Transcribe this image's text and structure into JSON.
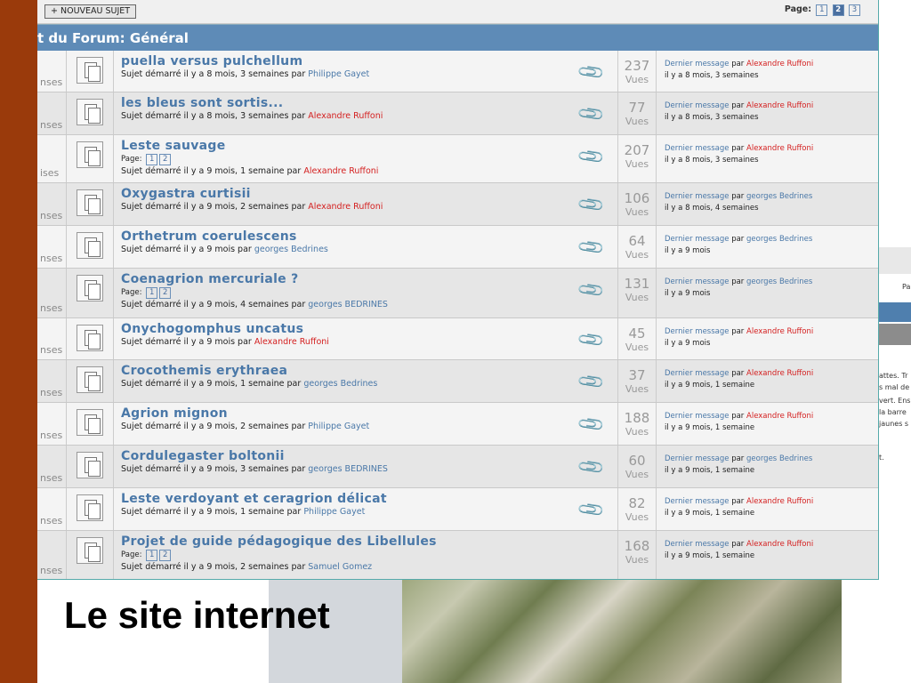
{
  "toolbar": {
    "new_topic_label": "+ NOUVEAU SUJET",
    "page_label": "Page:",
    "pages": [
      "1",
      "2",
      "3"
    ],
    "active_page": "2"
  },
  "forum_title": "t du Forum: Général",
  "caption": "Le site internet",
  "bg_window_texts": [
    "Pa",
    "attes. Tr",
    "s mal de",
    "vert. Ens",
    "la barre",
    "jaunes s",
    "t."
  ],
  "topics": [
    {
      "title": "puella versus pulchellum",
      "pages": [],
      "meta": "Sujet démarré il y a 8 mois, 3 semaines par",
      "author": "Philippe Gayet",
      "author_color": "blue",
      "views": "237",
      "views_label": "Vues",
      "last_label": "Dernier message",
      "last_par": "par",
      "last_author": "Alexandre Ruffoni",
      "last_color": "red",
      "last_when": "il y a 8 mois, 3 semaines",
      "resp": "nses",
      "clip": true
    },
    {
      "title": "les bleus sont sortis...",
      "pages": [],
      "meta": "Sujet démarré il y a 8 mois, 3 semaines par",
      "author": "Alexandre Ruffoni",
      "author_color": "red",
      "views": "77",
      "views_label": "Vues",
      "last_label": "Dernier message",
      "last_par": "par",
      "last_author": "Alexandre Ruffoni",
      "last_color": "red",
      "last_when": "il y a 8 mois, 3 semaines",
      "resp": "nses",
      "clip": true
    },
    {
      "title": "Leste sauvage",
      "pages": [
        "1",
        "2"
      ],
      "meta": "Sujet démarré il y a 9 mois, 1 semaine par",
      "author": "Alexandre Ruffoni",
      "author_color": "red",
      "views": "207",
      "views_label": "Vues",
      "last_label": "Dernier message",
      "last_par": "par",
      "last_author": "Alexandre Ruffoni",
      "last_color": "red",
      "last_when": "il y a 8 mois, 3 semaines",
      "resp": "ises",
      "clip": true
    },
    {
      "title": "Oxygastra curtisii",
      "pages": [],
      "meta": "Sujet démarré il y a 9 mois, 2 semaines par",
      "author": "Alexandre Ruffoni",
      "author_color": "red",
      "views": "106",
      "views_label": "Vues",
      "last_label": "Dernier message",
      "last_par": "par",
      "last_author": "georges Bedrines",
      "last_color": "blue",
      "last_when": "il y a 8 mois, 4 semaines",
      "resp": "nses",
      "clip": true
    },
    {
      "title": "Orthetrum coerulescens",
      "pages": [],
      "meta": "Sujet démarré il y a 9 mois par",
      "author": "georges Bedrines",
      "author_color": "blue",
      "views": "64",
      "views_label": "Vues",
      "last_label": "Dernier message",
      "last_par": "par",
      "last_author": "georges Bedrines",
      "last_color": "blue",
      "last_when": "il y a 9 mois",
      "resp": "nses",
      "clip": true
    },
    {
      "title": "Coenagrion mercuriale ?",
      "pages": [
        "1",
        "2"
      ],
      "meta": "Sujet démarré il y a 9 mois, 4 semaines par",
      "author": "georges BEDRINES",
      "author_color": "blue",
      "views": "131",
      "views_label": "Vues",
      "last_label": "Dernier message",
      "last_par": "par",
      "last_author": "georges Bedrines",
      "last_color": "blue",
      "last_when": "il y a 9 mois",
      "resp": "nses",
      "clip": true
    },
    {
      "title": "Onychogomphus uncatus",
      "pages": [],
      "meta": "Sujet démarré il y a 9 mois par",
      "author": "Alexandre Ruffoni",
      "author_color": "red",
      "views": "45",
      "views_label": "Vues",
      "last_label": "Dernier message",
      "last_par": "par",
      "last_author": "Alexandre Ruffoni",
      "last_color": "red",
      "last_when": "il y a 9 mois",
      "resp": "nses",
      "clip": true
    },
    {
      "title": "Crocothemis erythraea",
      "pages": [],
      "meta": "Sujet démarré il y a 9 mois, 1 semaine par",
      "author": "georges Bedrines",
      "author_color": "blue",
      "views": "37",
      "views_label": "Vues",
      "last_label": "Dernier message",
      "last_par": "par",
      "last_author": "Alexandre Ruffoni",
      "last_color": "red",
      "last_when": "il y a 9 mois, 1 semaine",
      "resp": "nses",
      "clip": true
    },
    {
      "title": "Agrion mignon",
      "pages": [],
      "meta": "Sujet démarré il y a 9 mois, 2 semaines par",
      "author": "Philippe Gayet",
      "author_color": "blue",
      "views": "188",
      "views_label": "Vues",
      "last_label": "Dernier message",
      "last_par": "par",
      "last_author": "Alexandre Ruffoni",
      "last_color": "red",
      "last_when": "il y a 9 mois, 1 semaine",
      "resp": "nses",
      "clip": true
    },
    {
      "title": "Cordulegaster boltonii",
      "pages": [],
      "meta": "Sujet démarré il y a 9 mois, 3 semaines par",
      "author": "georges BEDRINES",
      "author_color": "blue",
      "views": "60",
      "views_label": "Vues",
      "last_label": "Dernier message",
      "last_par": "par",
      "last_author": "georges Bedrines",
      "last_color": "blue",
      "last_when": "il y a 9 mois, 1 semaine",
      "resp": "nses",
      "clip": true
    },
    {
      "title": "Leste verdoyant et ceragrion délicat",
      "pages": [],
      "meta": "Sujet démarré il y a 9 mois, 1 semaine par",
      "author": "Philippe Gayet",
      "author_color": "blue",
      "views": "82",
      "views_label": "Vues",
      "last_label": "Dernier message",
      "last_par": "par",
      "last_author": "Alexandre Ruffoni",
      "last_color": "red",
      "last_when": "il y a 9 mois, 1 semaine",
      "resp": "nses",
      "clip": true
    },
    {
      "title": "Projet de guide pédagogique des Libellules",
      "pages": [
        "1",
        "2"
      ],
      "meta": "Sujet démarré il y a 9 mois, 2 semaines par",
      "author": "Samuel Gomez",
      "author_color": "blue",
      "views": "168",
      "views_label": "Vues",
      "last_label": "Dernier message",
      "last_par": "par",
      "last_author": "Alexandre Ruffoni",
      "last_color": "red",
      "last_when": "il y a 9 mois, 1 semaine",
      "resp": "nses",
      "clip": false
    }
  ]
}
